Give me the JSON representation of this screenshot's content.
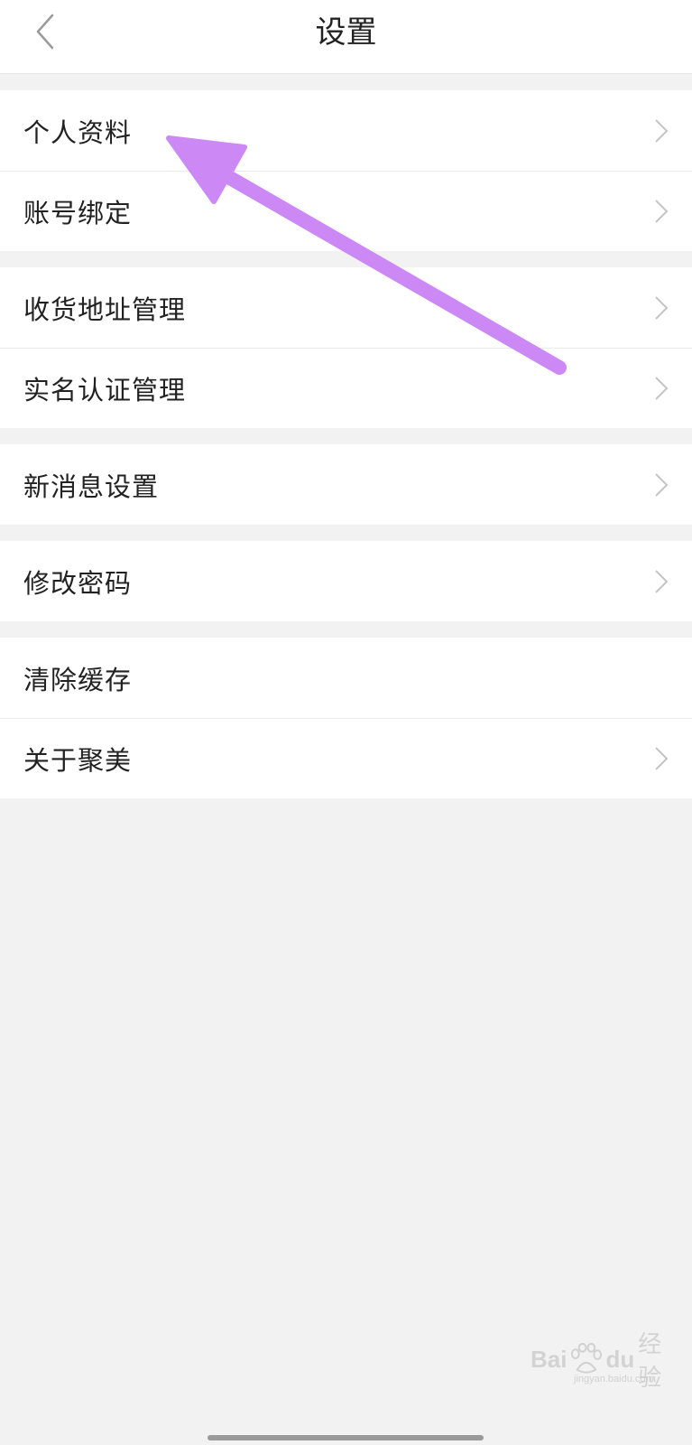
{
  "header": {
    "title": "设置"
  },
  "groups": [
    {
      "items": [
        {
          "label": "个人资料",
          "has_chevron": true
        },
        {
          "label": "账号绑定",
          "has_chevron": true
        }
      ]
    },
    {
      "items": [
        {
          "label": "收货地址管理",
          "has_chevron": true
        },
        {
          "label": "实名认证管理",
          "has_chevron": true
        }
      ]
    },
    {
      "items": [
        {
          "label": "新消息设置",
          "has_chevron": true
        }
      ]
    },
    {
      "items": [
        {
          "label": "修改密码",
          "has_chevron": true
        }
      ]
    },
    {
      "items": [
        {
          "label": "清除缓存",
          "has_chevron": false
        },
        {
          "label": "关于聚美",
          "has_chevron": true
        }
      ]
    }
  ],
  "annotation": {
    "color": "#cc88f5"
  },
  "watermark": {
    "brand_left": "Bai",
    "brand_right": "du",
    "brand_cn": "经验",
    "url": "jingyan.baidu.com"
  }
}
